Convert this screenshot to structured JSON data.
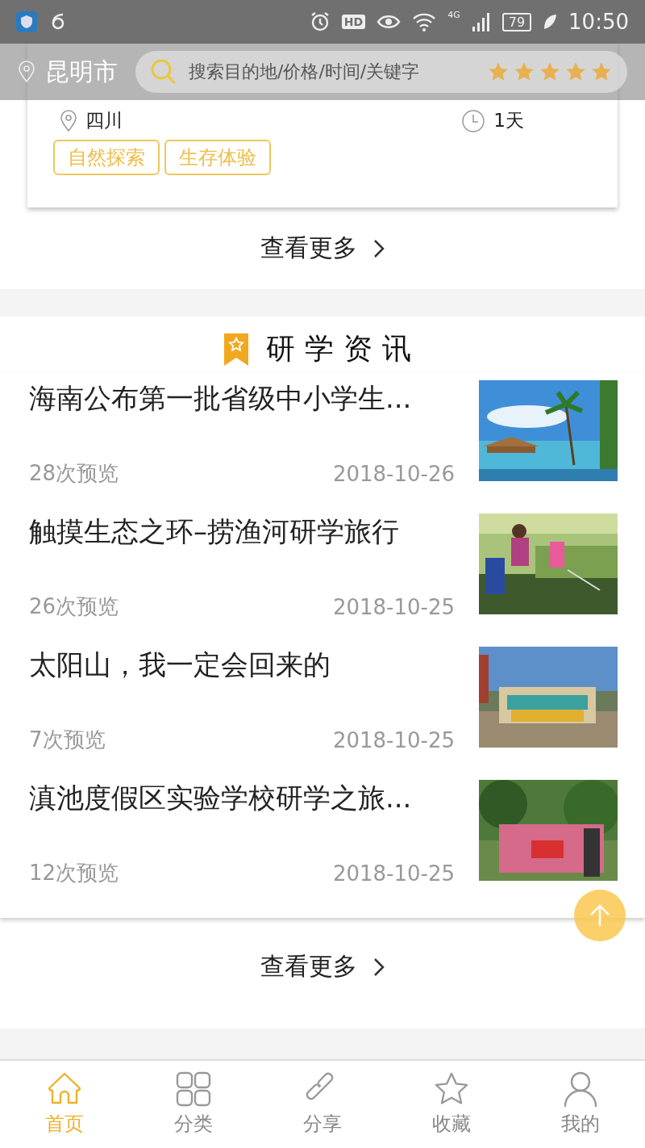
{
  "status_bar": {
    "time": "10:50",
    "battery": "79",
    "network": "4G",
    "hd": "HD"
  },
  "header": {
    "city": "昆明市",
    "search": {
      "placeholder": "搜索目的地/价格/时间/关键字"
    },
    "stars": 5
  },
  "tour_card": {
    "location": "四川",
    "duration": "1天",
    "tags": [
      "自然探索",
      "生存体验"
    ]
  },
  "tours_more": "查看更多",
  "news": {
    "title": "研学资讯",
    "items": [
      {
        "title": "海南公布第一批省级中小学生...",
        "views": "28次预览",
        "date": "2018-10-26"
      },
      {
        "title": "触摸生态之环–捞渔河研学旅行",
        "views": "26次预览",
        "date": "2018-10-25"
      },
      {
        "title": "太阳山，我一定会回来的",
        "views": "7次预览",
        "date": "2018-10-25"
      },
      {
        "title": "滇池度假区实验学校研学之旅...",
        "views": "12次预览",
        "date": "2018-10-25"
      }
    ],
    "more": "查看更多"
  },
  "tabbar": [
    {
      "label": "首页",
      "selected": true
    },
    {
      "label": "分类",
      "selected": false
    },
    {
      "label": "分享",
      "selected": false
    },
    {
      "label": "收藏",
      "selected": false
    },
    {
      "label": "我的",
      "selected": false
    }
  ]
}
